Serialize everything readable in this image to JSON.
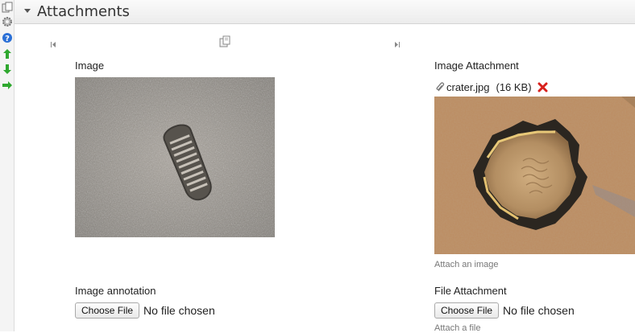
{
  "toolbar": {
    "icons": [
      "page-copy-icon",
      "gear-icon",
      "help-icon",
      "move-up-icon",
      "move-down-icon",
      "move-right-icon"
    ]
  },
  "section": {
    "title": "Attachments"
  },
  "fields": {
    "image": {
      "label": "Image"
    },
    "image_attachment": {
      "label": "Image Attachment",
      "filename": "crater.jpg",
      "filesize": "(16 KB)",
      "help": "Attach an image"
    },
    "image_annotation": {
      "label": "Image annotation",
      "button": "Choose File",
      "status": "No file chosen"
    },
    "file_attachment": {
      "label": "File Attachment",
      "button": "Choose File",
      "status": "No file chosen",
      "help": "Attach a file"
    }
  },
  "colors": {
    "header_bg": "#ececec",
    "remove_icon": "#d8201c",
    "arrow_green": "#2fa82f",
    "help_blue": "#2a6fd6"
  }
}
